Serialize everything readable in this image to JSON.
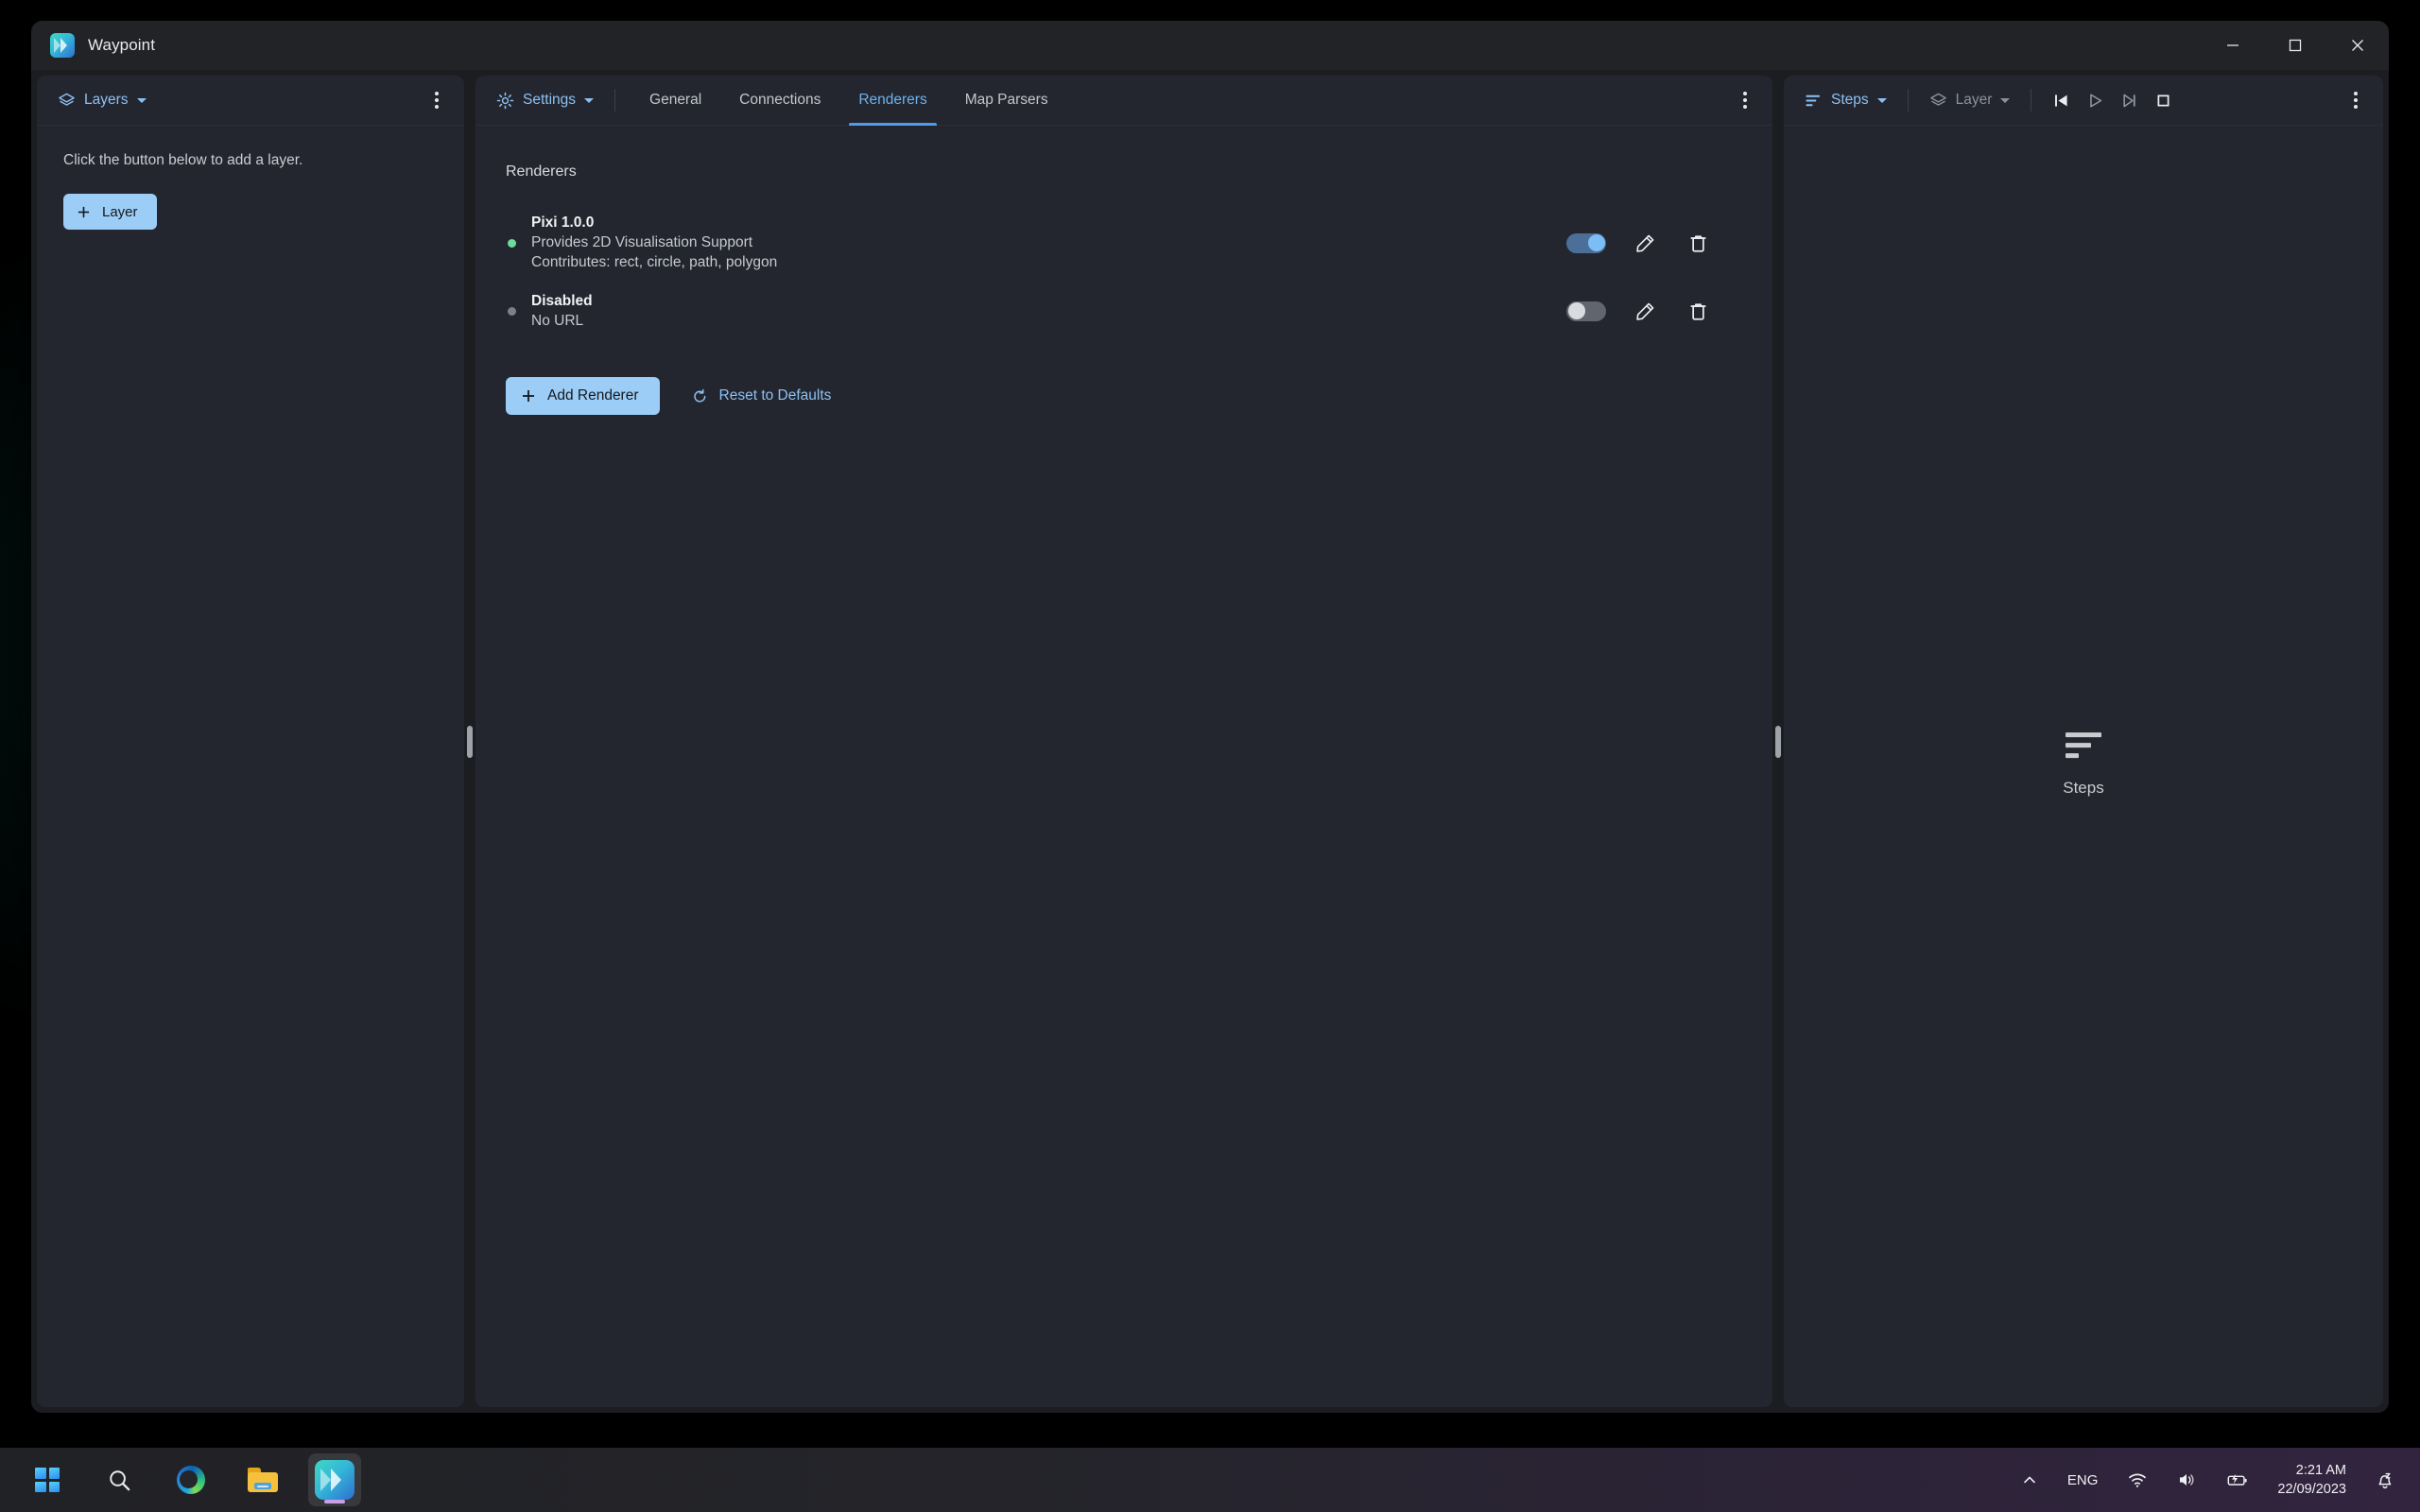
{
  "window": {
    "title": "Waypoint",
    "logo_icon": "waypoint-logo-icon",
    "controls": {
      "minimize": "minimize-icon",
      "maximize": "maximize-icon",
      "close": "close-icon"
    }
  },
  "layers_panel": {
    "header": {
      "icon": "layers-icon",
      "label": "Layers",
      "caret": "chevron-down-icon",
      "menu": "more-options-icon"
    },
    "empty_text": "Click the button below to add a layer.",
    "add_button": {
      "label": "Layer",
      "icon": "plus-icon"
    }
  },
  "settings_panel": {
    "header": {
      "icon": "gear-icon",
      "label": "Settings",
      "caret": "chevron-down-icon",
      "menu": "more-options-icon"
    },
    "tabs": [
      {
        "label": "General",
        "active": false
      },
      {
        "label": "Connections",
        "active": false
      },
      {
        "label": "Renderers",
        "active": true
      },
      {
        "label": "Map Parsers",
        "active": false
      }
    ],
    "section_heading": "Renderers",
    "renderers": [
      {
        "name": "Pixi 1.0.0",
        "desc_line1": "Provides 2D Visualisation Support",
        "desc_line2": "Contributes: rect, circle, path, polygon",
        "status": "enabled",
        "enabled": true,
        "edit_icon": "pencil-icon",
        "delete_icon": "trash-icon"
      },
      {
        "name": "Disabled",
        "desc_line1": "No URL",
        "desc_line2": "",
        "status": "disabled",
        "enabled": false,
        "edit_icon": "pencil-icon",
        "delete_icon": "trash-icon"
      }
    ],
    "actions": {
      "add_renderer": {
        "label": "Add Renderer",
        "icon": "plus-icon"
      },
      "reset_defaults": {
        "label": "Reset to Defaults",
        "icon": "reset-icon"
      }
    }
  },
  "steps_panel": {
    "header": {
      "icon": "steps-icon",
      "label": "Steps",
      "caret": "chevron-down-icon",
      "layer_icon": "layers-icon",
      "layer_label": "Layer",
      "layer_caret": "chevron-down-icon",
      "transport": {
        "skip_back": "skip-back-icon",
        "play": "play-icon",
        "skip_forward": "skip-forward-icon",
        "stop": "stop-icon"
      },
      "menu": "more-options-icon"
    },
    "empty": {
      "icon": "steps-icon",
      "label": "Steps"
    }
  },
  "colors": {
    "accent_blue": "#8cc0f4",
    "button_blue": "#9ccdf7",
    "tab_active": "#6cb2ef",
    "status_on": "#6ddc9a",
    "status_off": "#7b8089",
    "pane_bg": "#23262e",
    "window_bg": "#1c1d21",
    "titlebar_bg": "#222326"
  },
  "taskbar": {
    "items": [
      {
        "name": "start-button",
        "icon": "windows-logo-icon",
        "active": false
      },
      {
        "name": "search-button",
        "icon": "search-icon",
        "active": false
      },
      {
        "name": "edge-button",
        "icon": "edge-icon",
        "active": false
      },
      {
        "name": "file-explorer-button",
        "icon": "folder-icon",
        "active": false
      },
      {
        "name": "waypoint-taskbar-button",
        "icon": "waypoint-logo-icon",
        "active": true
      }
    ],
    "tray": {
      "overflow": "chevron-up-icon",
      "language": "ENG",
      "wifi": "wifi-icon",
      "volume": "speaker-icon",
      "battery": "battery-charging-icon",
      "time": "2:21 AM",
      "date": "22/09/2023",
      "notifications": "do-not-disturb-bell-icon"
    }
  }
}
